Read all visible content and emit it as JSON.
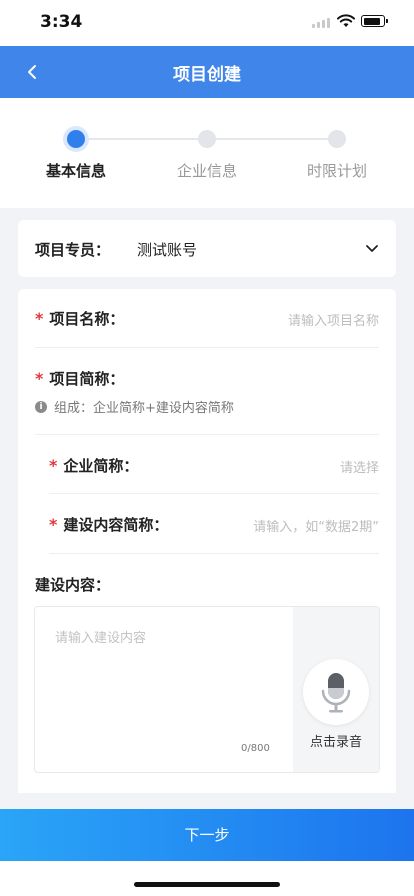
{
  "status_bar": {
    "time": "3:34"
  },
  "nav": {
    "title": "项目创建",
    "back_icon": "chevron-left-icon"
  },
  "steps": [
    {
      "label": "基本信息",
      "active": true
    },
    {
      "label": "企业信息",
      "active": false
    },
    {
      "label": "时限计划",
      "active": false
    }
  ],
  "specialist": {
    "label": "项目专员：",
    "value": "测试账号"
  },
  "form": {
    "project_name": {
      "label": "项目名称：",
      "placeholder": "请输入项目名称"
    },
    "project_abbr": {
      "label": "项目简称：",
      "hint": "组成：企业简称+建设内容简称"
    },
    "company_abbr": {
      "label": "企业简称：",
      "placeholder": "请选择"
    },
    "content_abbr": {
      "label": "建设内容简称：",
      "placeholder": "请输入，如“数据2期”"
    },
    "content": {
      "label": "建设内容：",
      "placeholder": "请输入建设内容",
      "count": "0/800",
      "voice_label": "点击录音"
    }
  },
  "next_button": "下一步",
  "colors": {
    "primary": "#3f85ea",
    "required": "#e0393e",
    "step_active": "#2f80ed"
  }
}
